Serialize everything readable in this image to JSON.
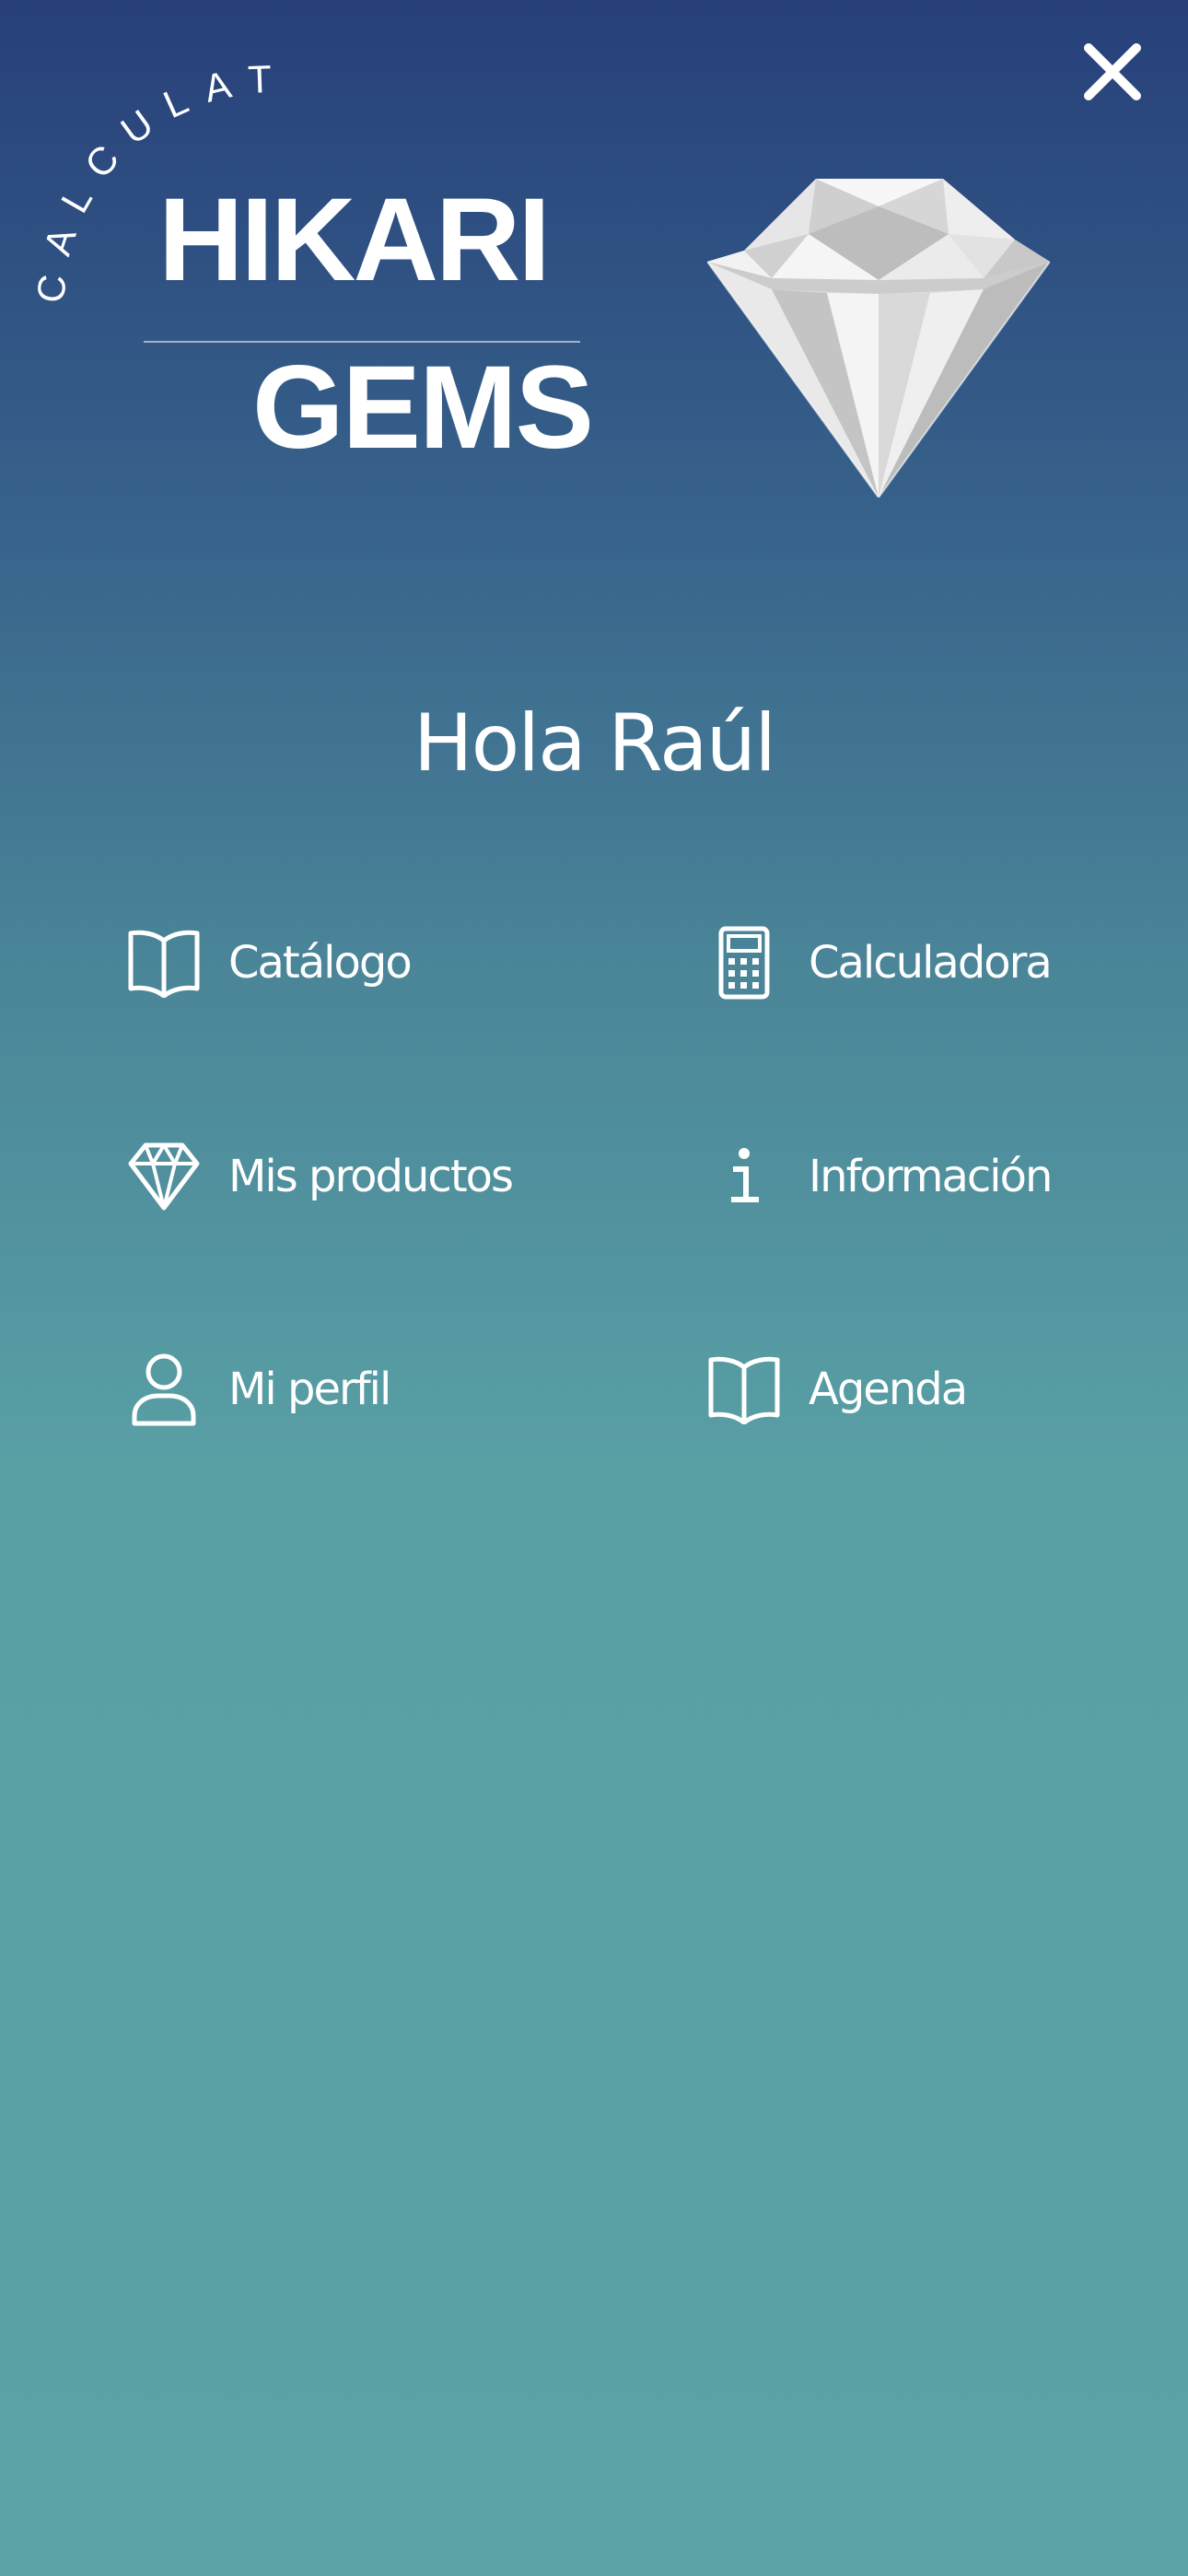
{
  "logo": {
    "arc_text": "CALCULATOR",
    "title_line1": "HIKARI",
    "title_line2": "GEMS"
  },
  "header": {
    "close_icon": "close-icon"
  },
  "greeting": "Hola Raúl",
  "menu": {
    "items": [
      {
        "label": "Catálogo",
        "icon": "book-icon"
      },
      {
        "label": "Calculadora",
        "icon": "calculator-icon"
      },
      {
        "label": "Mis productos",
        "icon": "diamond-icon"
      },
      {
        "label": "Información",
        "icon": "info-icon"
      },
      {
        "label": "Mi perfil",
        "icon": "user-icon"
      },
      {
        "label": "Agenda",
        "icon": "book-icon"
      }
    ]
  },
  "colors": {
    "gradient_top": "#27407a",
    "gradient_bottom": "#5ba3a6",
    "text": "#ffffff"
  }
}
